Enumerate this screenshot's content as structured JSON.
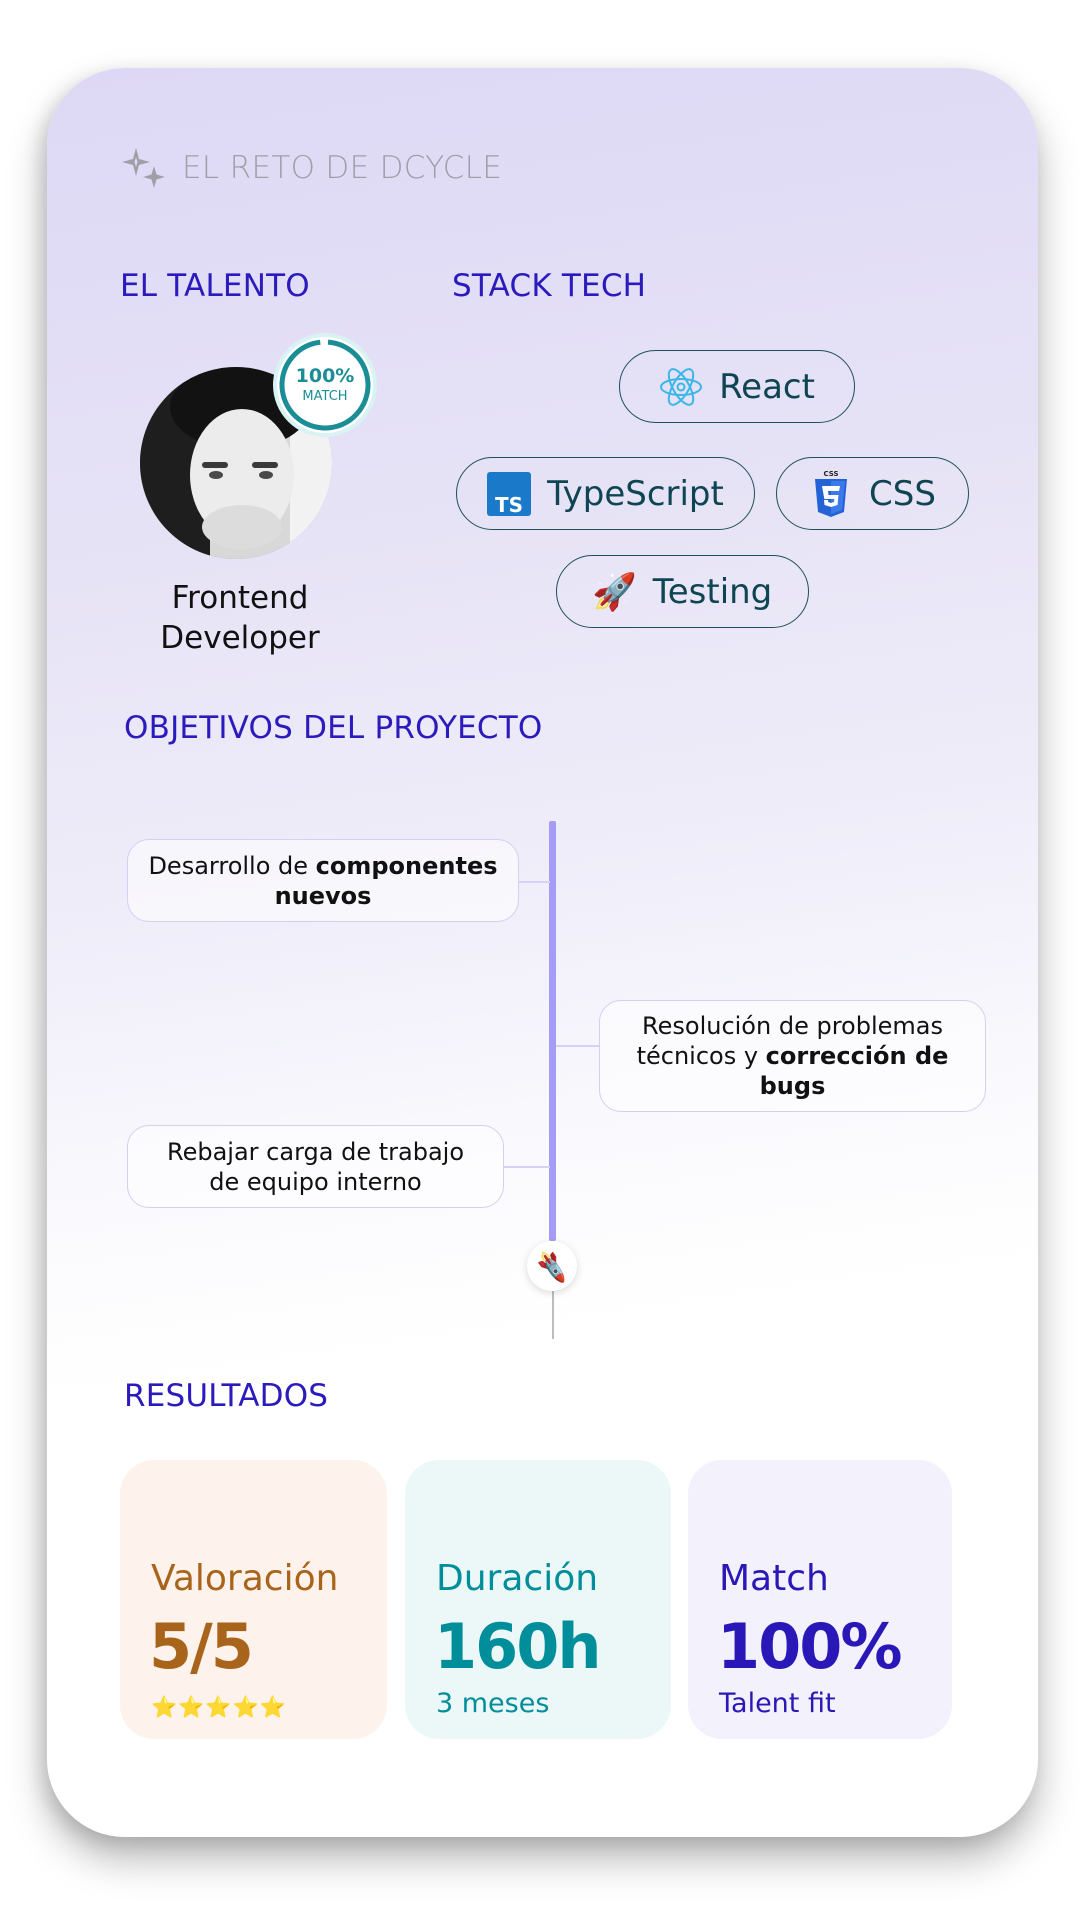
{
  "header": {
    "title": "EL RETO DE DCYCLE",
    "icon": "sparkles-icon"
  },
  "talent": {
    "section_title": "EL TALENTO",
    "match_badge": {
      "percent": "100%",
      "label": "MATCH",
      "match_fraction": 1.0
    },
    "role_line1": "Frontend",
    "role_line2": "Developer"
  },
  "stack": {
    "section_title": "STACK TECH",
    "items": [
      {
        "label": "React",
        "icon": "react-icon"
      },
      {
        "label": "TypeScript",
        "icon": "typescript-icon"
      },
      {
        "label": "CSS",
        "icon": "css3-icon"
      },
      {
        "label": "Testing",
        "icon": "rocket-icon"
      }
    ]
  },
  "objectives": {
    "section_title": "OBJETIVOS DEL PROYECTO",
    "items": [
      {
        "normal": "Desarrollo de ",
        "bold": "componentes nuevos",
        "normal2": ""
      },
      {
        "normal": "Resolución de problemas técnicos y ",
        "bold": "corrección de bugs",
        "normal2": ""
      },
      {
        "normal": "Rebajar carga de trabajo de equipo interno",
        "bold": "",
        "normal2": ""
      }
    ],
    "end_icon": "rocket-icon"
  },
  "results": {
    "section_title": "RESULTADOS",
    "cards": [
      {
        "label": "Valoración",
        "value": "5/5",
        "stars": "⭐⭐⭐⭐⭐",
        "rating": 5,
        "rating_max": 5,
        "color": "#a9641b",
        "bg": "#fdf3ec"
      },
      {
        "label": "Duración",
        "value": "160h",
        "sub": "3 meses",
        "color": "#008e9b",
        "bg": "#ecf7f8"
      },
      {
        "label": "Match",
        "value": "100%",
        "sub": "Talent fit",
        "color": "#2a17b8",
        "bg": "#f2f1fc"
      }
    ]
  },
  "colors": {
    "accent": "#2b1bbd",
    "teal": "#1a8d96",
    "timeline": "#a59cf5",
    "muted": "#a09ea6"
  }
}
